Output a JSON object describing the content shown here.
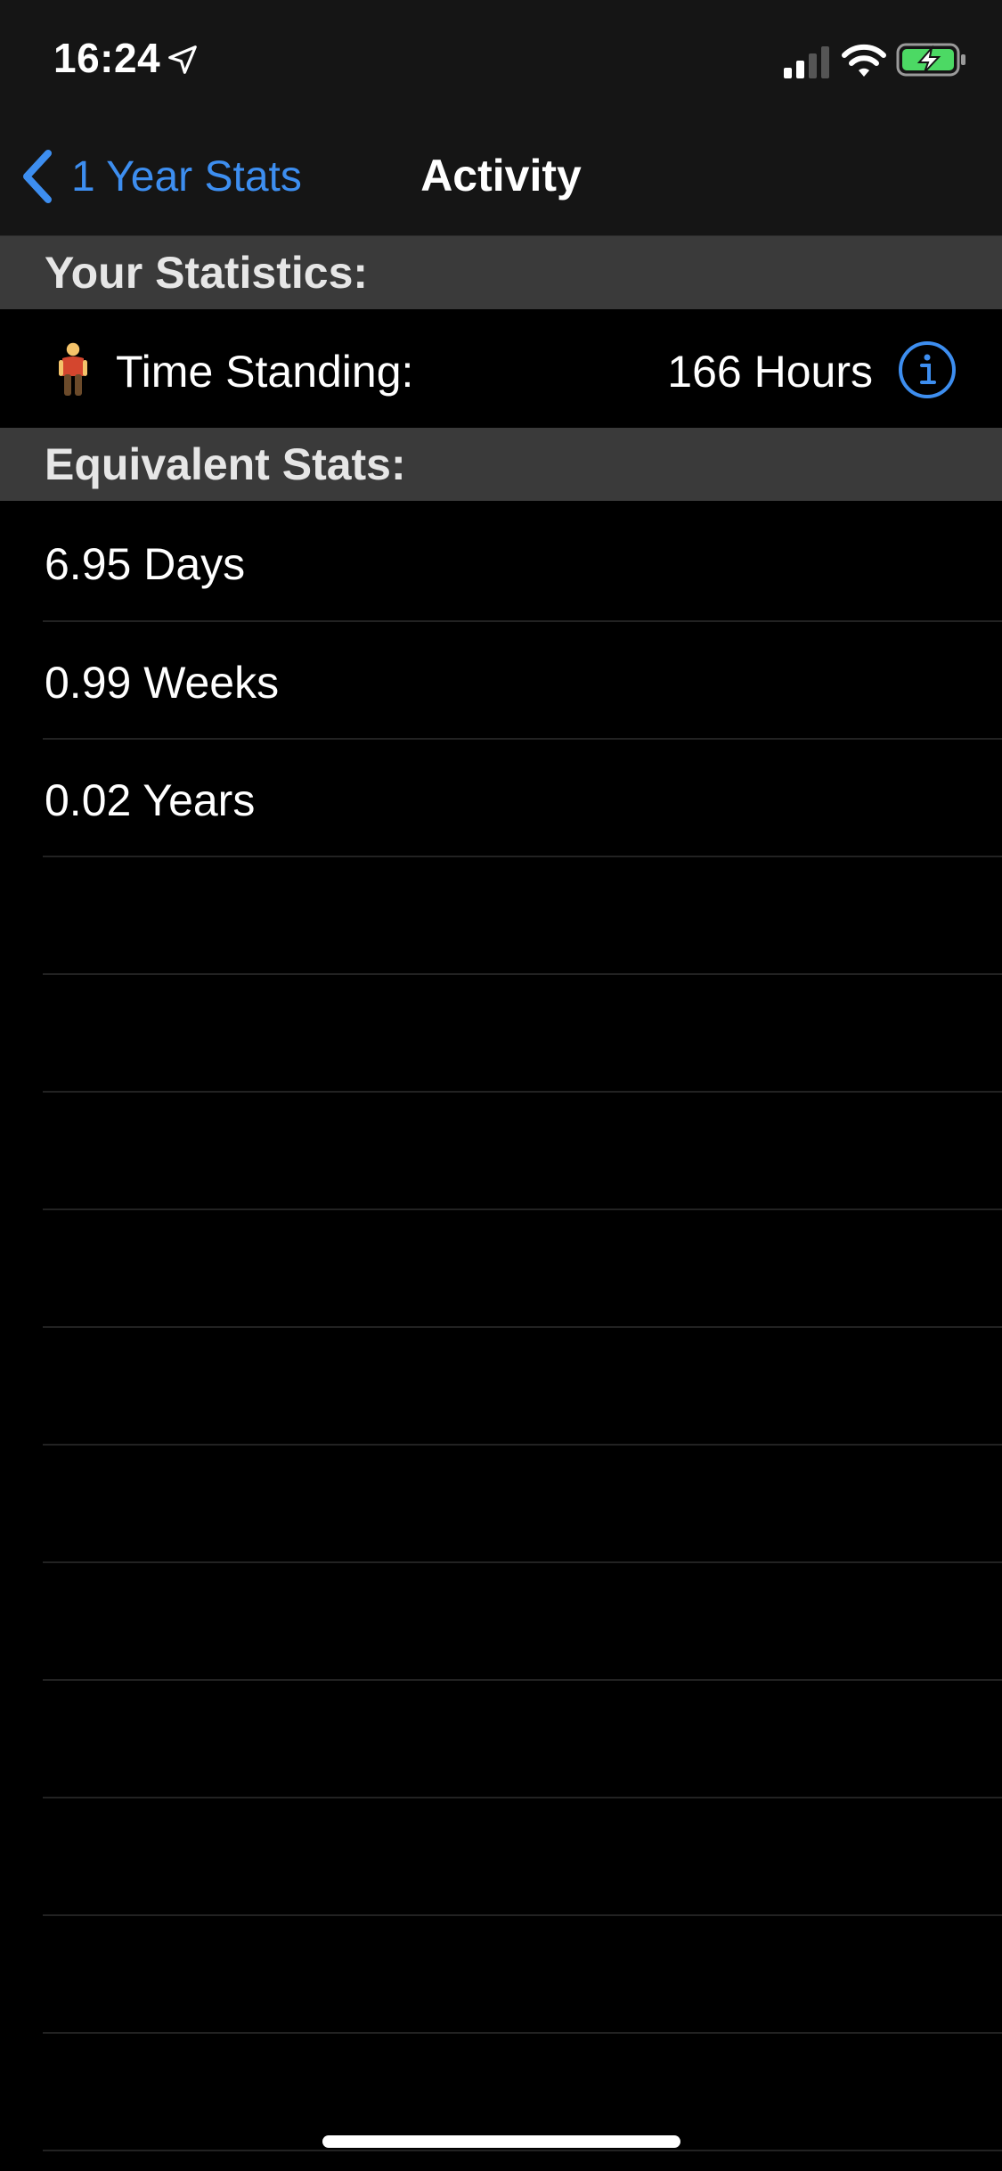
{
  "status_bar": {
    "time": "16:24",
    "icons": [
      "location-arrow-icon",
      "cellular-signal-icon",
      "wifi-icon",
      "battery-charging-icon"
    ],
    "battery_color": "#4cd964"
  },
  "nav": {
    "back_label": "1 Year Stats",
    "title": "Activity",
    "accent_color": "#3d8ef0"
  },
  "sections": {
    "your_statistics": "Your Statistics:",
    "equivalent_stats": "Equivalent Stats:"
  },
  "stat": {
    "icon": "standing-person-icon",
    "label": "Time Standing:",
    "value": "166 Hours",
    "info_icon": "info-icon"
  },
  "equivalents": [
    {
      "text": "6.95 Days"
    },
    {
      "text": "0.99 Weeks"
    },
    {
      "text": "0.02 Years"
    }
  ]
}
